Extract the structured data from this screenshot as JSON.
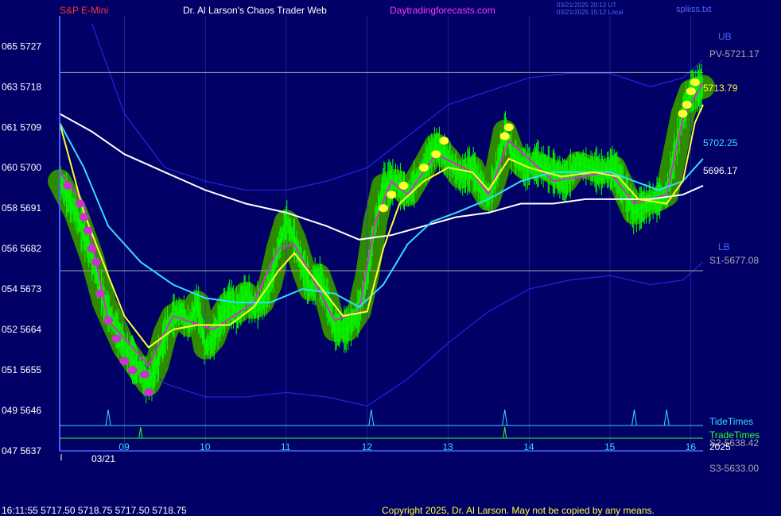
{
  "header": {
    "instrument": "S&P E-Mini",
    "site": "Dr. Al Larson's Chaos Trader Web",
    "url": "Daytradingforecasts.com",
    "utc_stamp": "03/21/2025 20:12 UT",
    "local_stamp": "03/21/2025 15:12 Local",
    "file": "spliiss.txt"
  },
  "footer": {
    "quote": "16:11:55  5717.50 5718.75 5717.50 5718.75",
    "copyright": "Copyright 2025, Dr. Al Larson. May not be copied by any means."
  },
  "colors": {
    "background": "#000066",
    "grid": "#3333cc",
    "price": "#00ff00",
    "halo": "#2e8b00",
    "mid": "#cc33cc",
    "fast_ma": "#ffff33",
    "cyan_ma": "#33ddff",
    "slow_ma": "#ffffff",
    "band": "#2222dd",
    "level": "#aaaaaa",
    "title": "#ff3333",
    "url": "#ff33ff"
  },
  "chart_data": {
    "type": "line",
    "title": "S&P E-Mini",
    "y_axis": {
      "ticks": [
        {
          "left": "065",
          "value": 5727
        },
        {
          "left": "063",
          "value": 5718
        },
        {
          "left": "061",
          "value": 5709
        },
        {
          "left": "060",
          "value": 5700
        },
        {
          "left": "058",
          "value": 5691
        },
        {
          "left": "056",
          "value": 5682
        },
        {
          "left": "054",
          "value": 5673
        },
        {
          "left": "052",
          "value": 5664
        },
        {
          "left": "051",
          "value": 5655
        },
        {
          "left": "049",
          "value": 5646
        },
        {
          "left": "047",
          "value": 5637
        }
      ],
      "range": [
        5637,
        5732
      ]
    },
    "x_axis": {
      "hour_ticks": [
        "09",
        "10",
        "11",
        "12",
        "13",
        "14",
        "15",
        "16"
      ],
      "range_hours": [
        8.2,
        16.15
      ],
      "date_label": "03/21"
    },
    "levels": [
      {
        "name": "PV-5721.17",
        "value": 5721.17
      },
      {
        "name": "S1-5677.08",
        "value": 5677.08
      }
    ],
    "right_labels": {
      "ub": "UB",
      "lb": "LB",
      "fast_ma": "5713.79",
      "cyan_ma": "5702.25",
      "slow_ma": "5696.17",
      "s2": "S2-5638.42",
      "s3": "S3-5633.00",
      "year": "2025"
    },
    "timing_lines": {
      "tide_label": "TideTimes",
      "trade_label": "TradeTimes",
      "tide_times": [
        8.8,
        12.05,
        13.7,
        15.3,
        15.7
      ],
      "trade_times": [
        9.2,
        13.7
      ]
    },
    "price_series": [
      [
        8.2,
        5697
      ],
      [
        8.4,
        5690
      ],
      [
        8.6,
        5680
      ],
      [
        8.75,
        5670
      ],
      [
        8.9,
        5664
      ],
      [
        9.0,
        5660
      ],
      [
        9.15,
        5656
      ],
      [
        9.3,
        5652
      ],
      [
        9.4,
        5656
      ],
      [
        9.5,
        5663
      ],
      [
        9.6,
        5667
      ],
      [
        9.7,
        5668
      ],
      [
        9.8,
        5665
      ],
      [
        9.9,
        5670
      ],
      [
        10.0,
        5660
      ],
      [
        10.1,
        5662
      ],
      [
        10.2,
        5667
      ],
      [
        10.3,
        5670
      ],
      [
        10.4,
        5668
      ],
      [
        10.5,
        5672
      ],
      [
        10.6,
        5669
      ],
      [
        10.7,
        5670
      ],
      [
        10.8,
        5674
      ],
      [
        10.9,
        5682
      ],
      [
        11.0,
        5688
      ],
      [
        11.1,
        5684
      ],
      [
        11.2,
        5678
      ],
      [
        11.3,
        5673
      ],
      [
        11.4,
        5676
      ],
      [
        11.5,
        5671
      ],
      [
        11.6,
        5664
      ],
      [
        11.75,
        5664
      ],
      [
        11.9,
        5668
      ],
      [
        12.0,
        5676
      ],
      [
        12.1,
        5688
      ],
      [
        12.2,
        5696
      ],
      [
        12.35,
        5697
      ],
      [
        12.5,
        5694
      ],
      [
        12.7,
        5700
      ],
      [
        12.85,
        5705
      ],
      [
        13.0,
        5702
      ],
      [
        13.15,
        5698
      ],
      [
        13.3,
        5700
      ],
      [
        13.4,
        5696
      ],
      [
        13.5,
        5693
      ],
      [
        13.6,
        5699
      ],
      [
        13.7,
        5708
      ],
      [
        13.8,
        5703
      ],
      [
        13.95,
        5700
      ],
      [
        14.1,
        5701
      ],
      [
        14.3,
        5699
      ],
      [
        14.45,
        5697
      ],
      [
        14.6,
        5701
      ],
      [
        14.75,
        5700
      ],
      [
        14.9,
        5699
      ],
      [
        15.05,
        5700
      ],
      [
        15.2,
        5694
      ],
      [
        15.3,
        5690
      ],
      [
        15.45,
        5692
      ],
      [
        15.6,
        5693
      ],
      [
        15.7,
        5694
      ],
      [
        15.8,
        5703
      ],
      [
        15.9,
        5712
      ],
      [
        16.0,
        5717
      ],
      [
        16.15,
        5718
      ]
    ],
    "mid_series": [
      [
        8.2,
        5699
      ],
      [
        8.5,
        5692
      ],
      [
        8.8,
        5666
      ],
      [
        9.3,
        5656
      ],
      [
        9.6,
        5667
      ],
      [
        10.1,
        5664
      ],
      [
        10.6,
        5670
      ],
      [
        10.9,
        5682
      ],
      [
        11.1,
        5683
      ],
      [
        11.6,
        5666
      ],
      [
        11.9,
        5668
      ],
      [
        12.1,
        5688
      ],
      [
        12.3,
        5697
      ],
      [
        12.5,
        5694
      ],
      [
        12.85,
        5703
      ],
      [
        13.3,
        5699
      ],
      [
        13.5,
        5694
      ],
      [
        13.75,
        5706
      ],
      [
        14.3,
        5697
      ],
      [
        15.0,
        5699
      ],
      [
        15.3,
        5692
      ],
      [
        15.7,
        5694
      ],
      [
        15.9,
        5711
      ],
      [
        16.15,
        5719
      ]
    ],
    "fast_ma": [
      [
        8.2,
        5710
      ],
      [
        8.5,
        5690
      ],
      [
        8.8,
        5676
      ],
      [
        9.0,
        5667
      ],
      [
        9.3,
        5660
      ],
      [
        9.6,
        5664
      ],
      [
        9.9,
        5665
      ],
      [
        10.3,
        5665
      ],
      [
        10.6,
        5669
      ],
      [
        10.9,
        5677
      ],
      [
        11.1,
        5681
      ],
      [
        11.4,
        5674
      ],
      [
        11.7,
        5667
      ],
      [
        12.0,
        5668
      ],
      [
        12.2,
        5682
      ],
      [
        12.4,
        5692
      ],
      [
        12.7,
        5697
      ],
      [
        13.0,
        5700
      ],
      [
        13.3,
        5699
      ],
      [
        13.5,
        5695
      ],
      [
        13.75,
        5702
      ],
      [
        14.0,
        5700
      ],
      [
        14.4,
        5698
      ],
      [
        14.8,
        5699
      ],
      [
        15.1,
        5698
      ],
      [
        15.35,
        5693
      ],
      [
        15.7,
        5692
      ],
      [
        15.9,
        5697
      ],
      [
        16.05,
        5710
      ],
      [
        16.15,
        5714
      ]
    ],
    "cyan_ma": [
      [
        8.2,
        5710
      ],
      [
        8.5,
        5700
      ],
      [
        8.8,
        5687
      ],
      [
        9.2,
        5679
      ],
      [
        9.6,
        5674
      ],
      [
        10.0,
        5671
      ],
      [
        10.4,
        5670
      ],
      [
        10.8,
        5670
      ],
      [
        11.2,
        5673
      ],
      [
        11.6,
        5672
      ],
      [
        11.9,
        5669
      ],
      [
        12.2,
        5674
      ],
      [
        12.5,
        5683
      ],
      [
        12.8,
        5688
      ],
      [
        13.1,
        5690
      ],
      [
        13.5,
        5693
      ],
      [
        13.9,
        5697
      ],
      [
        14.3,
        5699
      ],
      [
        14.7,
        5699
      ],
      [
        15.0,
        5699
      ],
      [
        15.3,
        5697
      ],
      [
        15.6,
        5695
      ],
      [
        15.9,
        5697
      ],
      [
        16.15,
        5702
      ]
    ],
    "slow_ma": [
      [
        8.2,
        5712
      ],
      [
        8.6,
        5708
      ],
      [
        9.0,
        5703
      ],
      [
        9.5,
        5699
      ],
      [
        10.0,
        5695
      ],
      [
        10.5,
        5692
      ],
      [
        11.0,
        5690
      ],
      [
        11.5,
        5687
      ],
      [
        11.9,
        5684
      ],
      [
        12.3,
        5685
      ],
      [
        12.7,
        5687
      ],
      [
        13.1,
        5689
      ],
      [
        13.5,
        5690
      ],
      [
        13.9,
        5692
      ],
      [
        14.3,
        5692
      ],
      [
        14.7,
        5693
      ],
      [
        15.1,
        5693
      ],
      [
        15.5,
        5693
      ],
      [
        15.9,
        5694
      ],
      [
        16.15,
        5696
      ]
    ],
    "upper_band": [
      [
        8.6,
        5732
      ],
      [
        9.0,
        5712
      ],
      [
        9.5,
        5700
      ],
      [
        10.0,
        5697
      ],
      [
        10.5,
        5695
      ],
      [
        11.0,
        5695
      ],
      [
        11.5,
        5697
      ],
      [
        12.0,
        5700
      ],
      [
        12.5,
        5707
      ],
      [
        13.0,
        5714
      ],
      [
        13.5,
        5717
      ],
      [
        14.0,
        5720
      ],
      [
        14.5,
        5721
      ],
      [
        15.0,
        5721
      ],
      [
        15.5,
        5718
      ],
      [
        15.9,
        5720
      ],
      [
        16.15,
        5724
      ]
    ],
    "lower_band": [
      [
        9.0,
        5660
      ],
      [
        9.5,
        5652
      ],
      [
        10.0,
        5649
      ],
      [
        10.5,
        5649
      ],
      [
        11.0,
        5650
      ],
      [
        11.5,
        5649
      ],
      [
        12.0,
        5647
      ],
      [
        12.5,
        5653
      ],
      [
        13.0,
        5661
      ],
      [
        13.5,
        5668
      ],
      [
        14.0,
        5673
      ],
      [
        14.5,
        5675
      ],
      [
        15.0,
        5676
      ],
      [
        15.5,
        5674
      ],
      [
        15.9,
        5675
      ],
      [
        16.15,
        5679
      ]
    ],
    "yellow_dots": [
      [
        12.2,
        5691
      ],
      [
        12.3,
        5694
      ],
      [
        12.45,
        5696
      ],
      [
        12.7,
        5700
      ],
      [
        12.85,
        5703
      ],
      [
        12.95,
        5706
      ],
      [
        13.7,
        5707
      ],
      [
        13.75,
        5709
      ],
      [
        15.9,
        5712
      ],
      [
        15.95,
        5714
      ],
      [
        16.0,
        5717
      ],
      [
        16.05,
        5719
      ]
    ],
    "magenta_dots": [
      [
        8.3,
        5696
      ],
      [
        8.45,
        5692
      ],
      [
        8.5,
        5689
      ],
      [
        8.55,
        5686
      ],
      [
        8.6,
        5682
      ],
      [
        8.65,
        5679
      ],
      [
        8.7,
        5672
      ],
      [
        8.8,
        5666
      ],
      [
        8.9,
        5662
      ],
      [
        9.0,
        5657
      ],
      [
        9.1,
        5655
      ],
      [
        9.25,
        5654
      ],
      [
        9.3,
        5650
      ]
    ]
  }
}
